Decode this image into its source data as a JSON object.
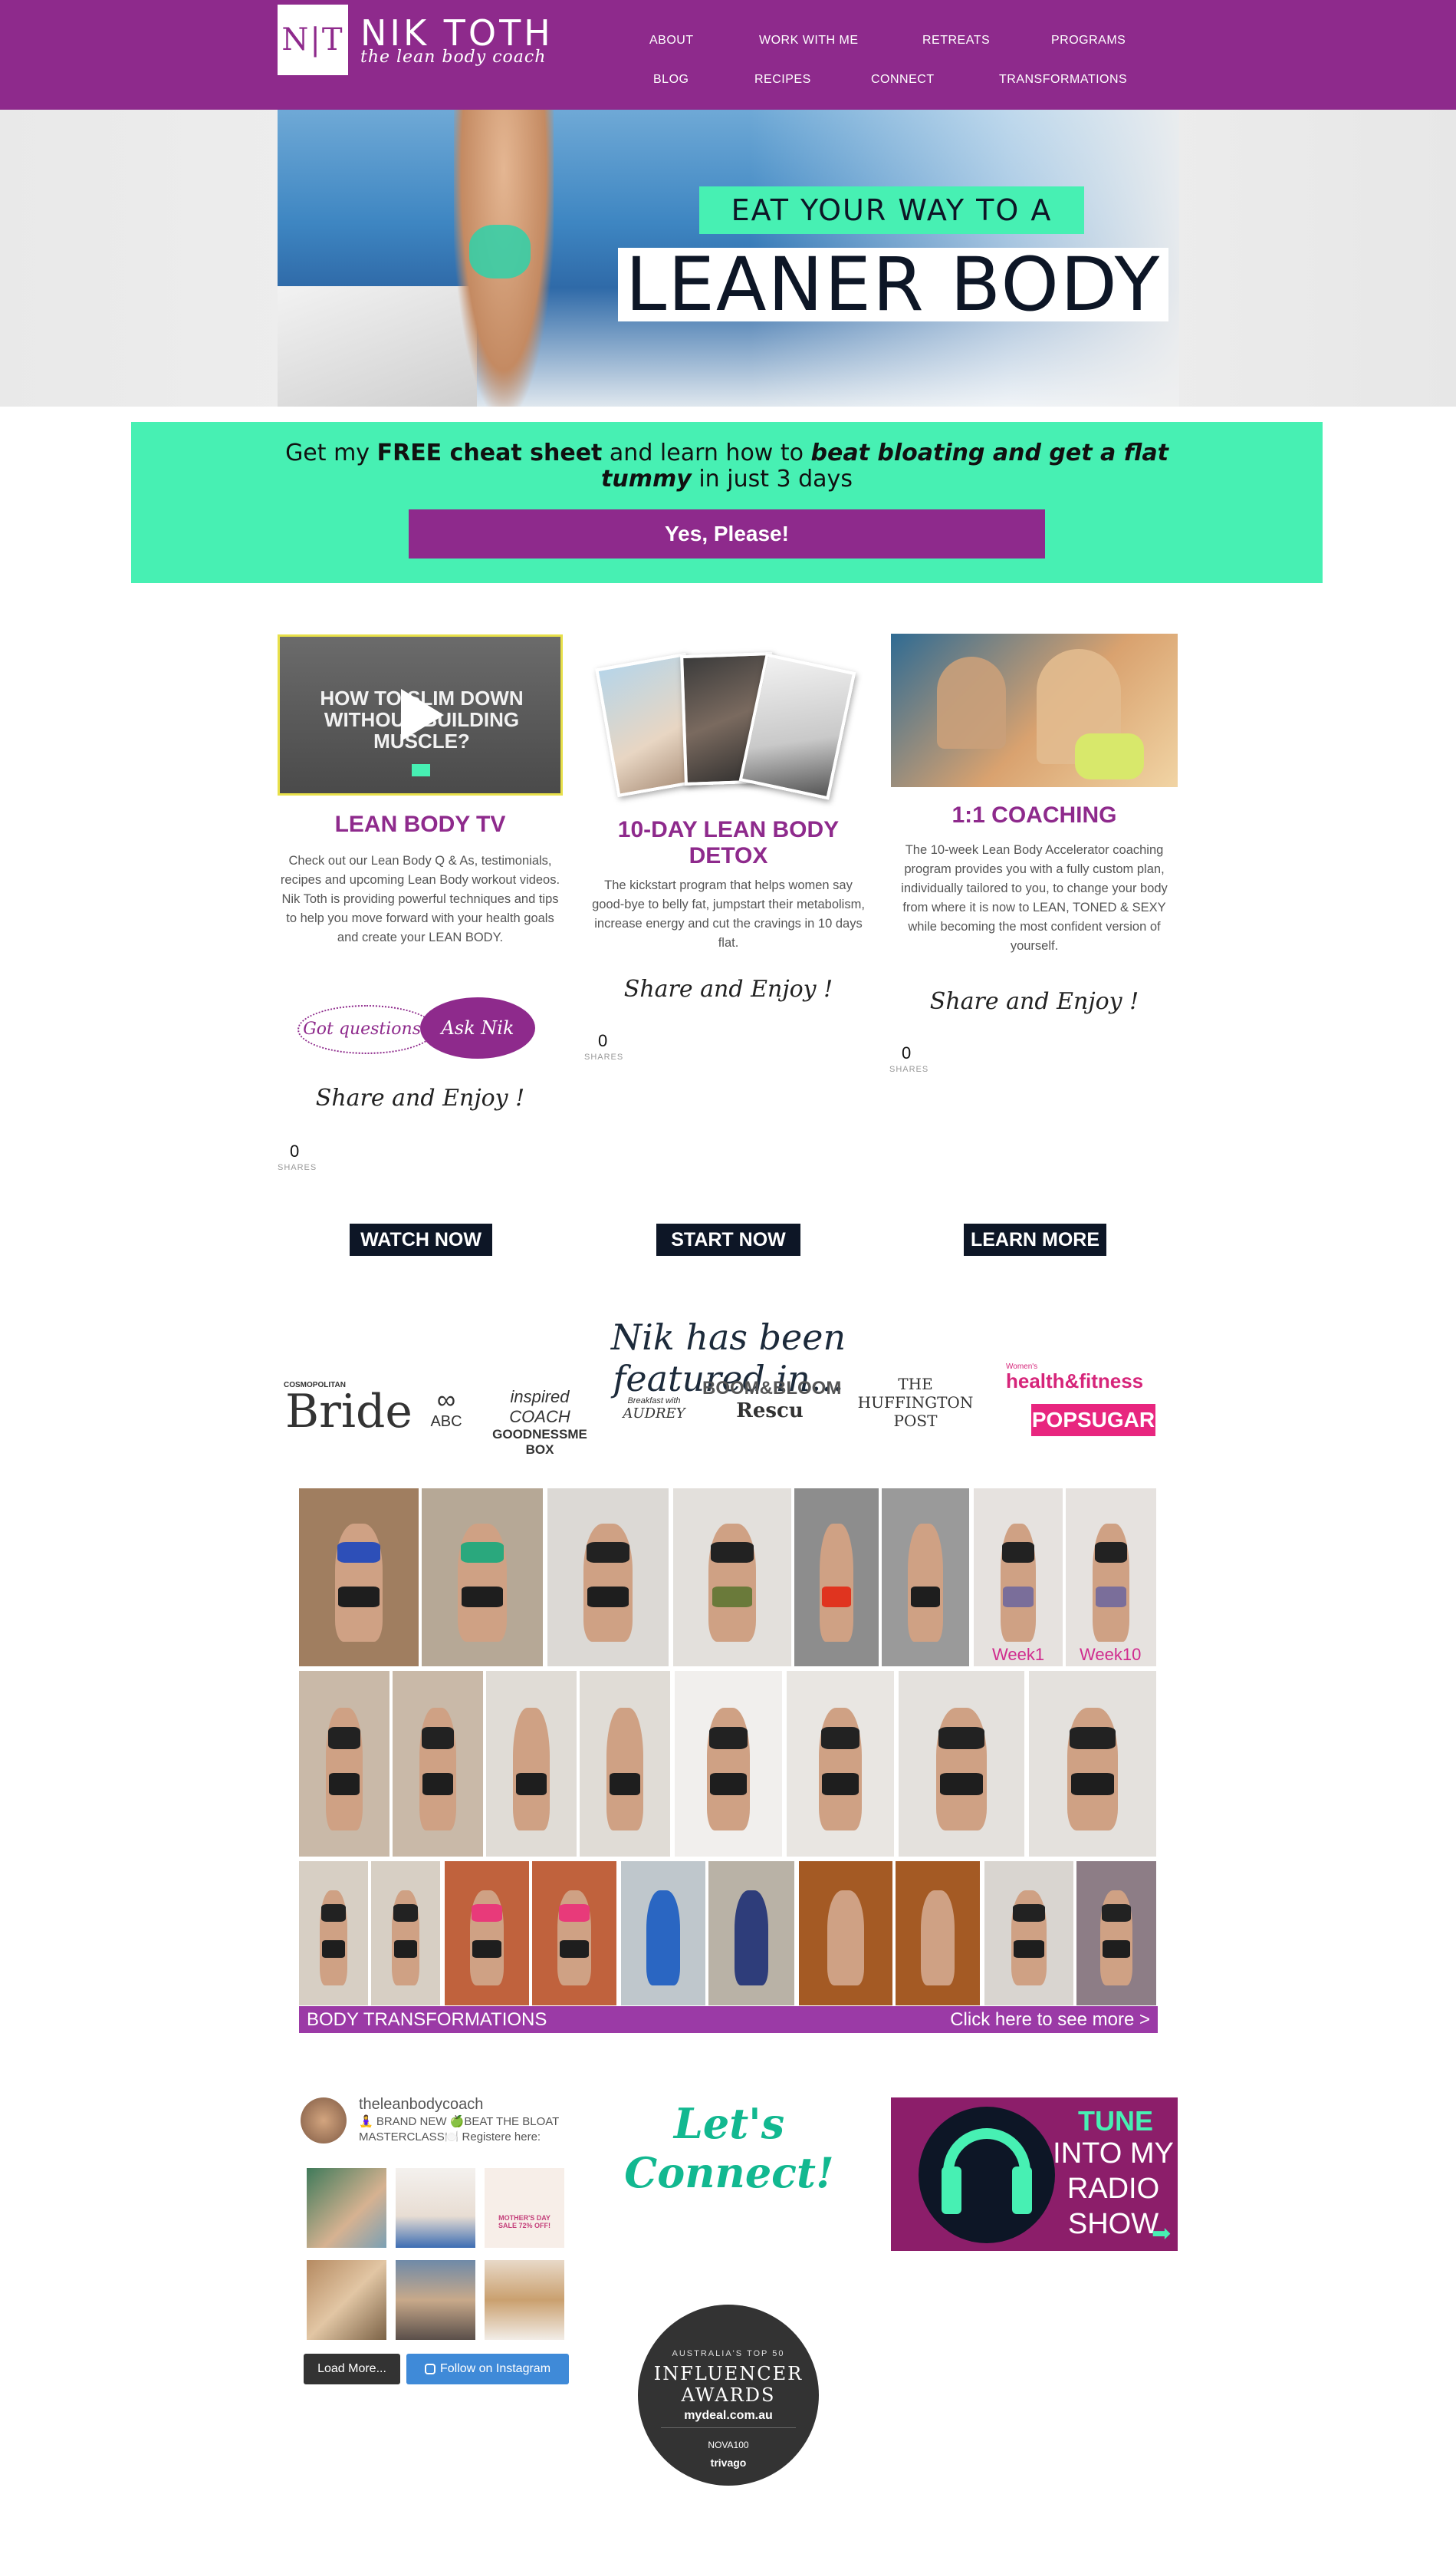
{
  "header": {
    "logo_mark": "N|T",
    "brand_name": "NIK TOTH",
    "tagline": "the lean body coach",
    "nav_row1": [
      "ABOUT",
      "WORK WITH ME",
      "RETREATS",
      "PROGRAMS"
    ],
    "nav_row2": [
      "BLOG",
      "RECIPES",
      "CONNECT",
      "TRANSFORMATIONS"
    ]
  },
  "hero": {
    "subtitle": "EAT YOUR WAY TO A",
    "title": "LEANER BODY"
  },
  "banner": {
    "text_prefix": "Get my ",
    "text_bold": "FREE cheat sheet",
    "text_mid": " and learn how to ",
    "text_bold_italic": "beat bloating and get a flat tummy",
    "text_suffix": " in just 3 days",
    "button_label": "Yes, Please!"
  },
  "columns": [
    {
      "image_overlay": "HOW TO SLIM DOWN WITHOUT BUILDING MUSCLE?",
      "title": "LEAN BODY TV",
      "body": "Check out our Lean Body Q & As, testimonials, recipes and upcoming Lean Body workout videos. Nik Toth is providing powerful techniques and tips to help you move forward with your health goals and create your LEAN BODY.",
      "ask_left": "Got questions?",
      "ask_right": "Ask Nik",
      "share_text": "Share and Enjoy !",
      "share_count": "0",
      "share_label": "SHARES",
      "cta": "WATCH NOW"
    },
    {
      "title": "10-DAY LEAN BODY DETOX",
      "body": "The kickstart program that helps women say good-bye to belly fat, jumpstart their metabolism, increase energy and cut the cravings in 10 days flat.",
      "share_text": "Share and Enjoy !",
      "share_count": "0",
      "share_label": "SHARES",
      "cta": "START NOW"
    },
    {
      "title": "1:1 COACHING",
      "body": "The 10-week Lean Body Accelerator coaching program provides you with a fully custom plan, individually tailored to you, to change your body from where it is now to LEAN, TONED & SEXY while becoming the most confident version of yourself.",
      "share_text": "Share and Enjoy !",
      "share_count": "0",
      "share_label": "SHARES",
      "cta": "LEARN MORE"
    }
  ],
  "featured": {
    "heading": "Nik has been featured in...",
    "logos": [
      {
        "top": "COSMOPOLITAN",
        "main": "Bride"
      },
      {
        "top": "",
        "main": "ABC"
      },
      {
        "top": "inspired COACH",
        "main": "GOODNESSME BOX"
      },
      {
        "top": "Breakfast with",
        "main": "AUDREY"
      },
      {
        "top": "BOOM&BLOOM",
        "main": "Rescu"
      },
      {
        "top": "THE",
        "main": "HUFFINGTON POST"
      },
      {
        "top": "Women's",
        "main": "health&fitness"
      },
      {
        "top": "",
        "main": "POPSUGAR"
      }
    ]
  },
  "transformations": {
    "week_labels": [
      "Week1",
      "Week10"
    ],
    "bar_left": "BODY TRANSFORMATIONS",
    "bar_right": "Click here to see more >"
  },
  "instagram": {
    "username": "theleanbodycoach",
    "caption": "🧘‍♀️ BRAND NEW 🍏BEAT THE BLOAT MASTERCLASS🍽️ Registere here:",
    "thumb3_text": "MOTHER'S DAY SALE 72% OFF!",
    "load_more": "Load More...",
    "follow": "Follow on Instagram"
  },
  "connect": {
    "heading": "Let's Connect!"
  },
  "radio": {
    "tune": "TUNE",
    "line1": "INTO MY",
    "line2": "RADIO",
    "line3": "SHOW"
  },
  "award": {
    "line1": "AUSTRALIA'S TOP 50",
    "line2": "INFLUENCER AWARDS",
    "line3": "mydeal.com.au",
    "line4": "NOVA100",
    "line5": "trivago"
  },
  "colors": {
    "brand_purple": "#8e2a8c",
    "mint": "#47f0b3",
    "navy": "#0d1626"
  }
}
